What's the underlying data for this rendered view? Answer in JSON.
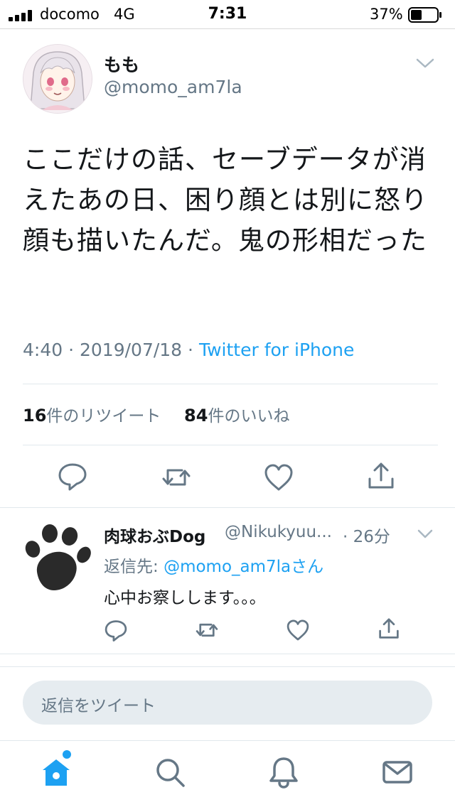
{
  "status_bar": {
    "carrier": "docomo",
    "network": "4G",
    "time": "7:31",
    "battery_percent": "37%"
  },
  "tweet": {
    "display_name": "もも",
    "handle": "@momo_am7la",
    "text": "ここだけの話、セーブデータが消えたあの日、困り顔とは別に怒り顔も描いたんだ。鬼の形相だった",
    "time": "4:40",
    "date": "2019/07/18",
    "source": "Twitter for iPhone",
    "retweet_count": "16",
    "retweet_label": "件のリツイート",
    "like_count": "84",
    "like_label": "件のいいね"
  },
  "reply": {
    "display_name": "肉球おぶDog",
    "handle": "@Nikukyuu...",
    "time": "26分",
    "reply_to_label": "返信先: ",
    "reply_to_mention": "@momo_am7laさん",
    "text": "心中お察しします。。。"
  },
  "compose": {
    "placeholder": "返信をツイート"
  },
  "colors": {
    "accent": "#1da1f2",
    "secondary_text": "#657786",
    "primary_text": "#14171a",
    "divider": "#e1e8ed"
  },
  "icons": {
    "actions": [
      "reply-icon",
      "retweet-icon",
      "like-icon",
      "share-icon"
    ],
    "tabs": [
      "home-icon",
      "search-icon",
      "notifications-icon",
      "messages-icon"
    ]
  }
}
